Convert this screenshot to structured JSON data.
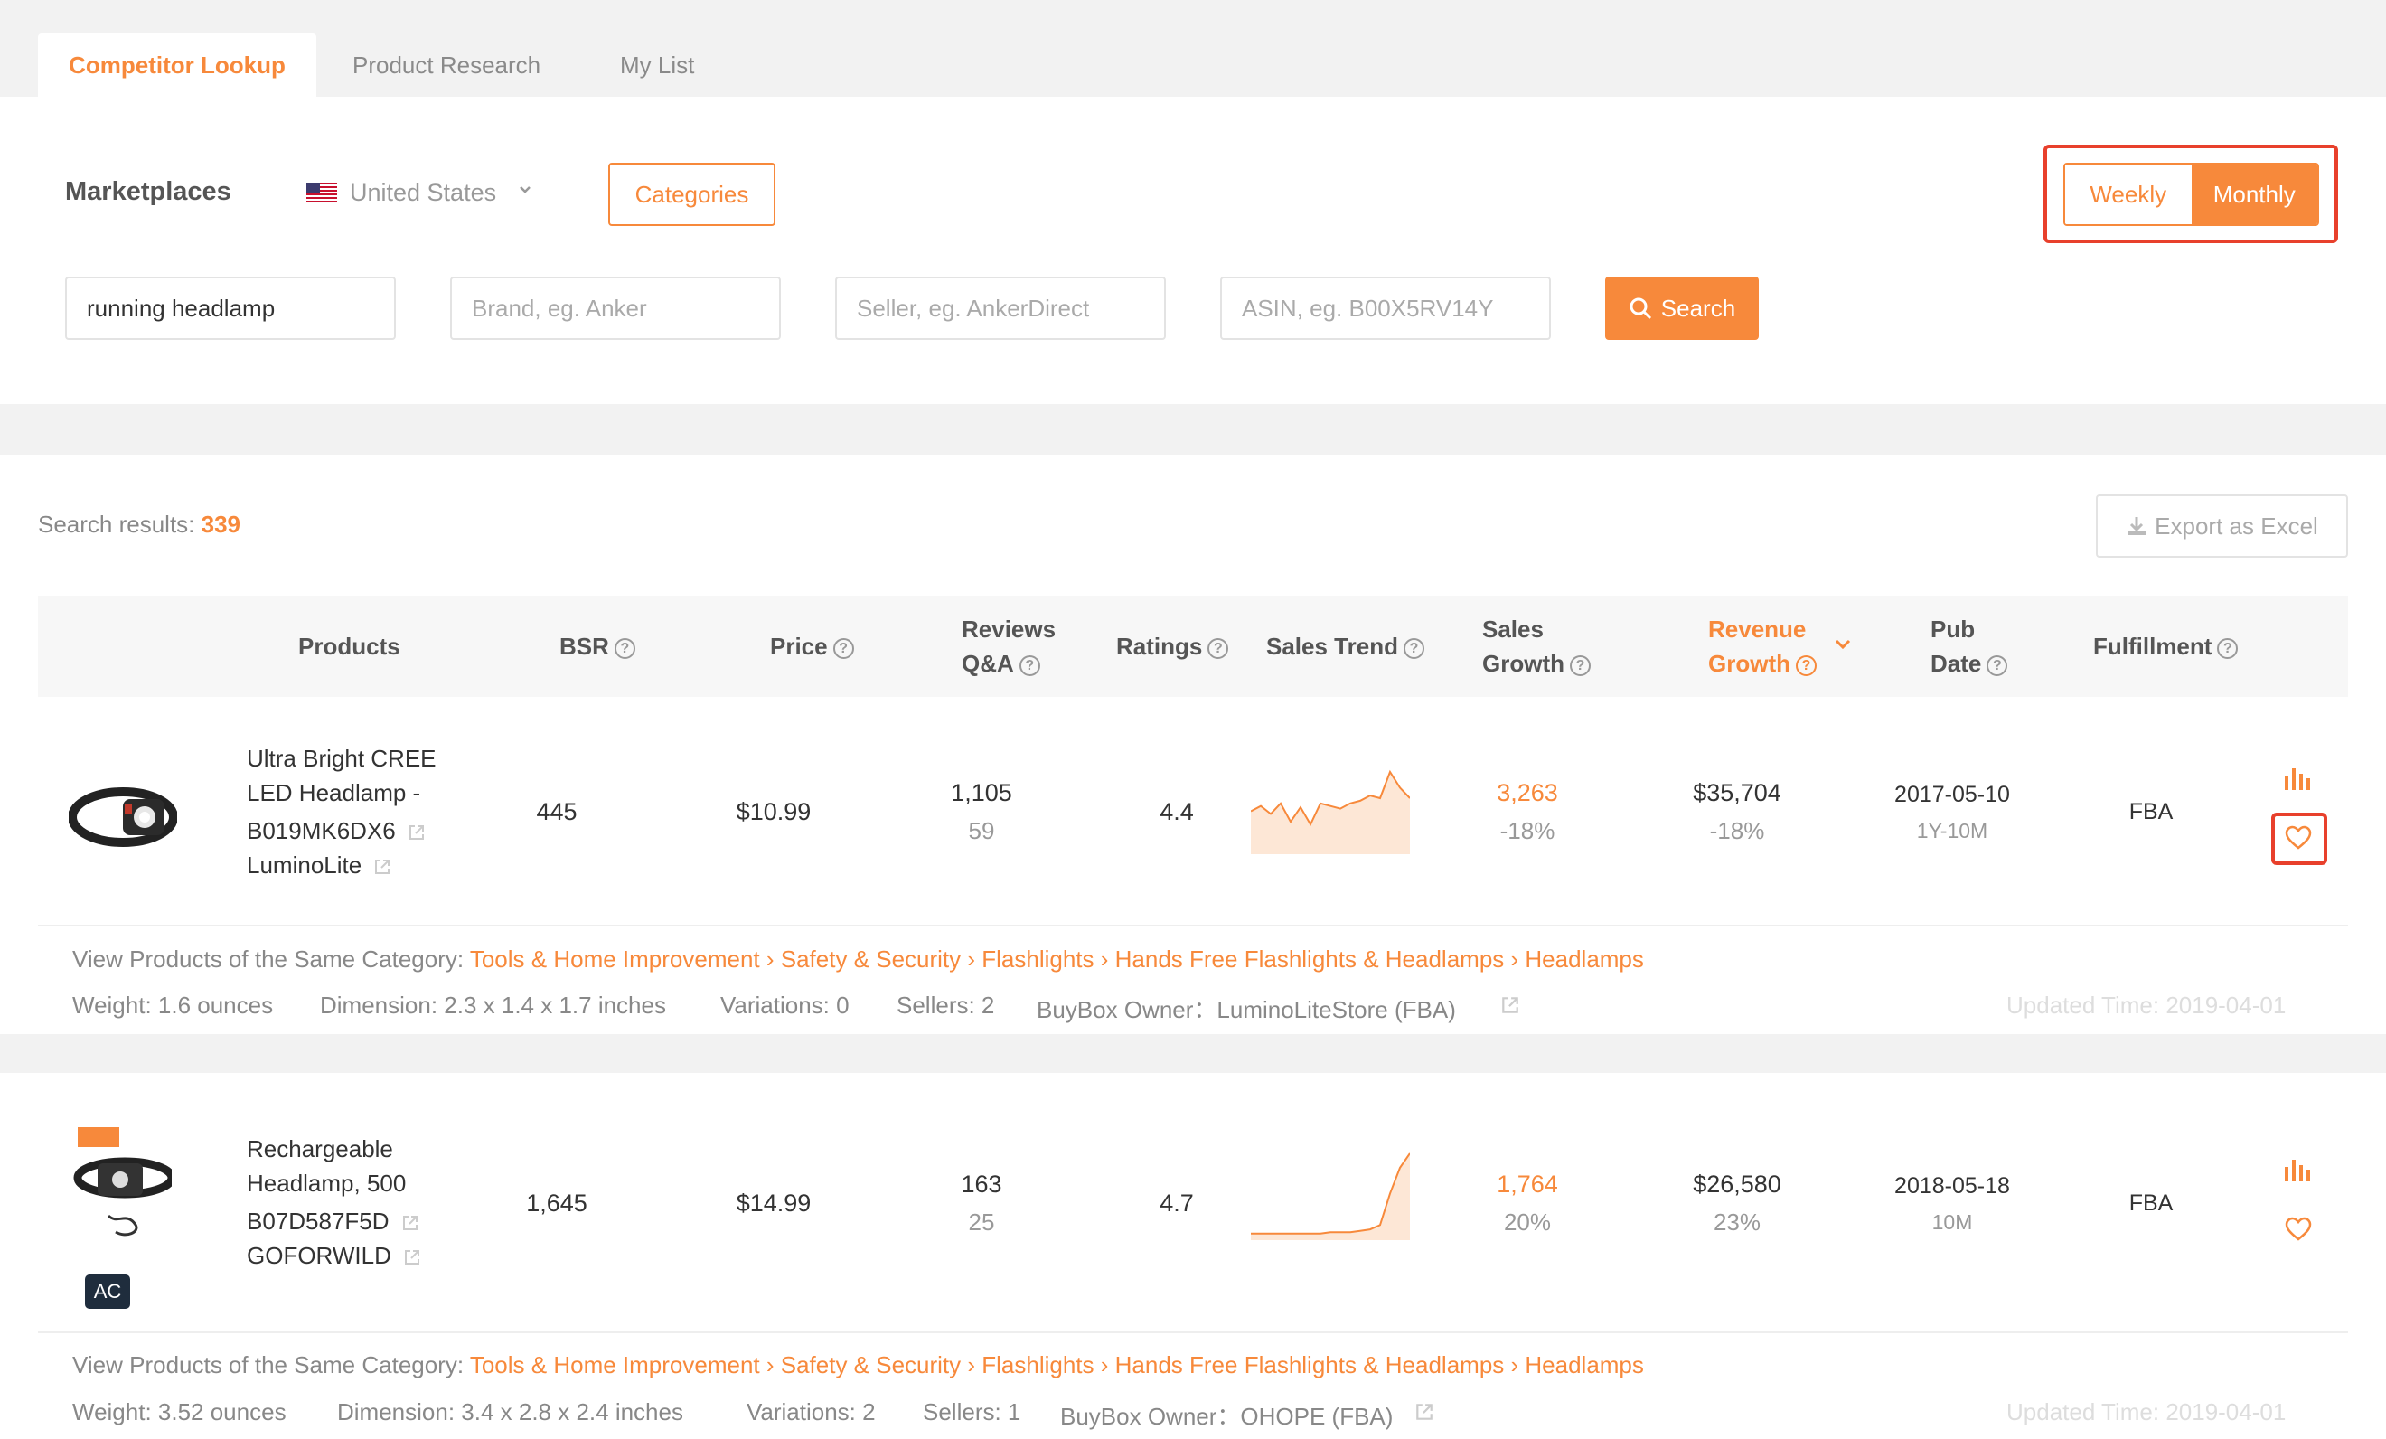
{
  "tabs": [
    {
      "label": "Competitor Lookup",
      "active": true
    },
    {
      "label": "Product Research",
      "active": false
    },
    {
      "label": "My List",
      "active": false
    }
  ],
  "filters": {
    "marketplaces_label": "Marketplaces",
    "marketplace_value": "United States",
    "categories_label": "Categories",
    "period_options": [
      "Weekly",
      "Monthly"
    ],
    "period_selected": "Monthly",
    "keyword_value": "running headlamp",
    "brand_placeholder": "Brand, eg. Anker",
    "seller_placeholder": "Seller, eg. AnkerDirect",
    "asin_placeholder": "ASIN, eg. B00X5RV14Y",
    "search_label": "Search"
  },
  "results": {
    "label": "Search results:",
    "count": "339",
    "export_label": "Export as Excel"
  },
  "table": {
    "headers": {
      "products": "Products",
      "bsr": "BSR",
      "price": "Price",
      "reviews_line1": "Reviews",
      "reviews_line2": "Q&A",
      "ratings": "Ratings",
      "sales_trend": "Sales Trend",
      "sales_growth_line1": "Sales",
      "sales_growth_line2": "Growth",
      "revenue_growth_line1": "Revenue",
      "revenue_growth_line2": "Growth",
      "pub_date_line1": "Pub",
      "pub_date_line2": "Date",
      "fulfillment": "Fulfillment"
    },
    "rows": [
      {
        "title_line1": "Ultra Bright CREE",
        "title_line2": "LED Headlamp -",
        "asin": "B019MK6DX6",
        "brand": "LuminoLite",
        "bsr": "445",
        "price": "$10.99",
        "reviews": "1,105",
        "qa": "59",
        "rating": "4.4",
        "sales_trend": [
          30,
          34,
          28,
          36,
          22,
          33,
          20,
          36,
          34,
          32,
          36,
          38,
          42,
          40,
          60,
          48,
          40
        ],
        "sales": "3,263",
        "sales_growth": "-18%",
        "revenue": "$35,704",
        "revenue_growth": "-18%",
        "pub_date": "2017-05-10",
        "age": "1Y-10M",
        "fulfillment": "FBA",
        "category_label": "View Products of the Same Category:",
        "category_path": "Tools & Home Improvement › Safety & Security › Flashlights › Hands Free Flashlights & Headlamps › Headlamps",
        "weight": "Weight: 1.6 ounces",
        "dimension": "Dimension: 2.3 x 1.4 x 1.7 inches",
        "variations": "Variations: 0",
        "sellers": "Sellers: 2",
        "buybox": "BuyBox Owner：LuminoLiteStore (FBA)",
        "updated": "Updated Time: 2019-04-01"
      },
      {
        "title_line1": "Rechargeable",
        "title_line2": "Headlamp, 500",
        "asin": "B07D587F5D",
        "brand": "GOFORWILD",
        "bsr": "1,645",
        "price": "$14.99",
        "reviews": "163",
        "qa": "25",
        "rating": "4.7",
        "sales_trend": [
          2,
          2,
          2,
          2,
          2,
          2,
          2,
          2,
          3,
          3,
          3,
          4,
          5,
          8,
          30,
          48,
          58
        ],
        "sales": "1,764",
        "sales_growth": "20%",
        "revenue": "$26,580",
        "revenue_growth": "23%",
        "pub_date": "2018-05-18",
        "age": "10M",
        "fulfillment": "FBA",
        "badge": "AC",
        "category_label": "View Products of the Same Category:",
        "category_path": "Tools & Home Improvement › Safety & Security › Flashlights › Hands Free Flashlights & Headlamps › Headlamps",
        "weight": "Weight: 3.52 ounces",
        "dimension": "Dimension: 3.4 x 2.8 x 2.4 inches",
        "variations": "Variations: 2",
        "sellers": "Sellers: 1",
        "buybox": "BuyBox Owner：OHOPE (FBA)",
        "updated": "Updated Time: 2019-04-01"
      }
    ]
  },
  "colors": {
    "accent": "#f7893b",
    "highlight_frame": "#e8402c",
    "badge": "#1f2d3d"
  }
}
